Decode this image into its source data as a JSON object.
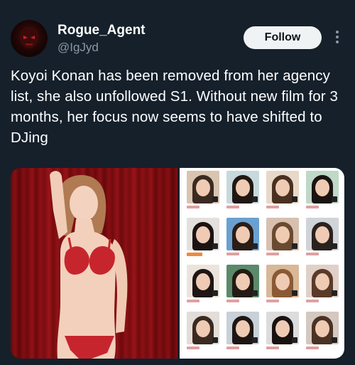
{
  "author": {
    "display_name": "Rogue_Agent",
    "handle": "@IgJyd",
    "avatar_icon": "avatar-icon"
  },
  "actions": {
    "follow_label": "Follow",
    "more_icon": "more-vertical-icon"
  },
  "tweet": {
    "text": "Koyoi Konan has been removed from her agency list, she also unfollowed S1. Without new film for 3 months, her focus now seems to have shifted to DJing"
  },
  "colors": {
    "background": "#15202b",
    "text_primary": "#ffffff",
    "text_secondary": "#8b98a5",
    "follow_button_bg": "#eff3f4",
    "follow_button_text": "#0f1419",
    "curtain_red": "#8a1115"
  },
  "media": {
    "images": [
      {
        "kind": "photo-portrait"
      },
      {
        "kind": "profile-grid",
        "rows": 4,
        "columns": 4
      }
    ]
  }
}
